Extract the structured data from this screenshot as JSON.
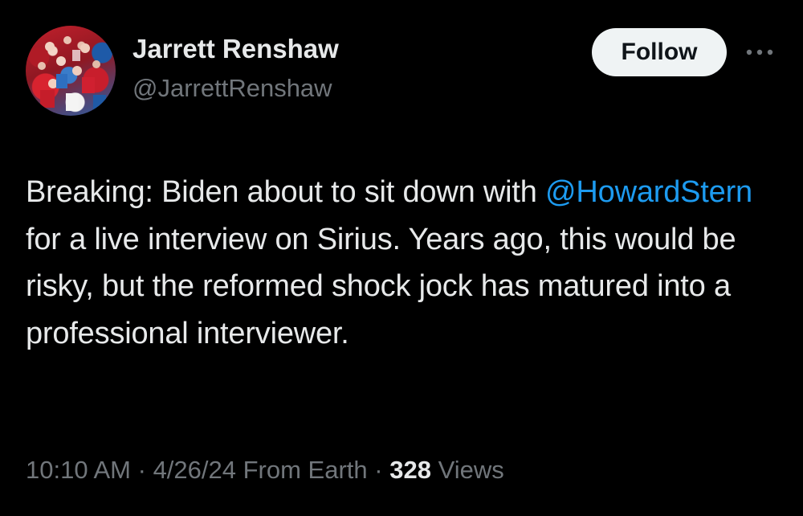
{
  "author": {
    "display_name": "Jarrett Renshaw",
    "handle": "@JarrettRenshaw",
    "avatar_icon": "profile-photo-crowd"
  },
  "actions": {
    "follow_label": "Follow",
    "more_icon": "more-dots-icon"
  },
  "tweet": {
    "text_before": "Breaking: Biden about to sit down with",
    "mention": "@HowardStern",
    "text_after": "for a live interview on Sirius. Years ago, this would be risky, but the reformed shock jock has matured into a professional interviewer."
  },
  "meta": {
    "time": "10:10 AM",
    "date": "4/26/24",
    "source": "From Earth",
    "views_count": "328",
    "views_label": "Views",
    "separator": "·"
  },
  "colors": {
    "background": "#000000",
    "text": "#e7e9ea",
    "secondary": "#71767b",
    "link": "#1d9bf0",
    "button_bg": "#eff3f4"
  }
}
